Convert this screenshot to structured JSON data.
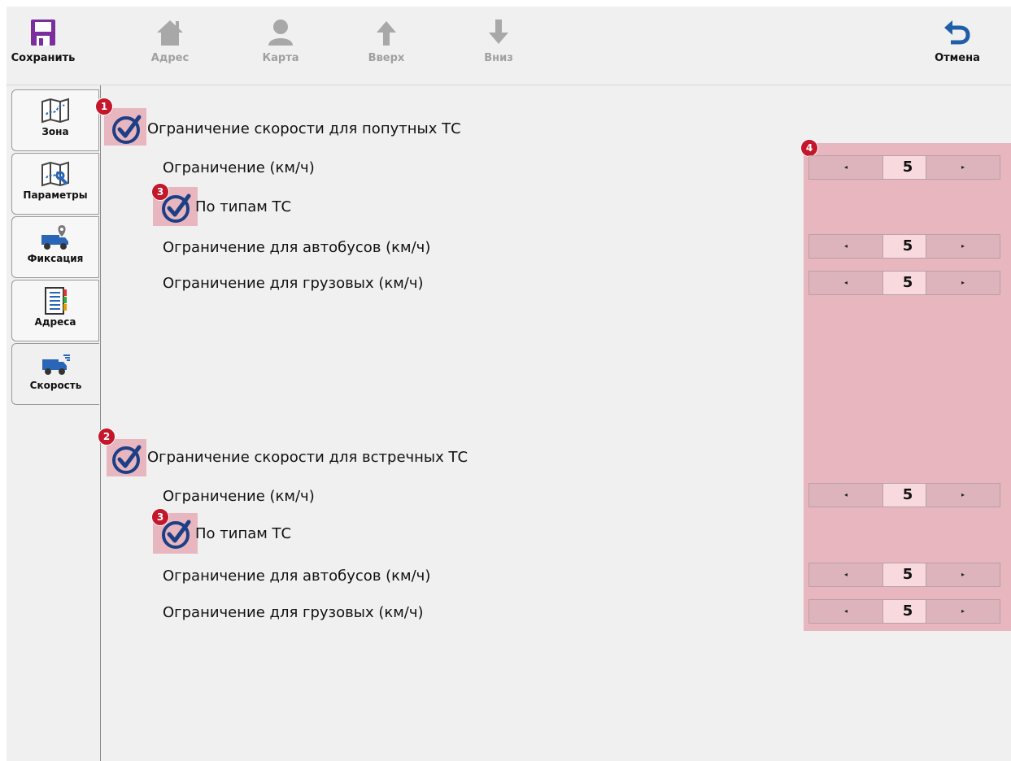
{
  "toolbar": {
    "save": "Сохранить",
    "address": "Адрес",
    "map": "Карта",
    "up": "Вверх",
    "down": "Вниз",
    "cancel": "Отмена"
  },
  "sidebar": {
    "tabs": [
      {
        "label": "Зона",
        "icon": "zone-map-icon"
      },
      {
        "label": "Параметры",
        "icon": "parameters-icon"
      },
      {
        "label": "Фиксация",
        "icon": "fixation-truck-icon"
      },
      {
        "label": "Адреса",
        "icon": "addresses-book-icon"
      },
      {
        "label": "Скорость",
        "icon": "speed-truck-icon",
        "active": true
      }
    ]
  },
  "markers": [
    "1",
    "2",
    "3",
    "3",
    "4"
  ],
  "sections": [
    {
      "title": "Ограничение скорости для попутных ТС",
      "checked": true,
      "limit_label": "Ограничение (км/ч)",
      "limit_value": "5",
      "by_type_label": "По типам ТС",
      "by_type_checked": true,
      "bus_label": "Ограничение для автобусов (км/ч)",
      "bus_value": "5",
      "truck_label": "Ограничение для грузовых (км/ч)",
      "truck_value": "5"
    },
    {
      "title": "Ограничение скорости для встречных ТС",
      "checked": true,
      "limit_label": "Ограничение (км/ч)",
      "limit_value": "5",
      "by_type_label": "По типам ТС",
      "by_type_checked": true,
      "bus_label": "Ограничение для автобусов (км/ч)",
      "bus_value": "5",
      "truck_label": "Ограничение для грузовых (км/ч)",
      "truck_value": "5"
    }
  ],
  "stepper": {
    "left_arrow": "◂",
    "right_arrow": "▸"
  },
  "colors": {
    "accent": "#1c3f86",
    "save_icon": "#7b2f9e",
    "cancel_icon": "#1f5fa8",
    "highlight": "#e7b6bf",
    "marker": "#c4172c"
  }
}
